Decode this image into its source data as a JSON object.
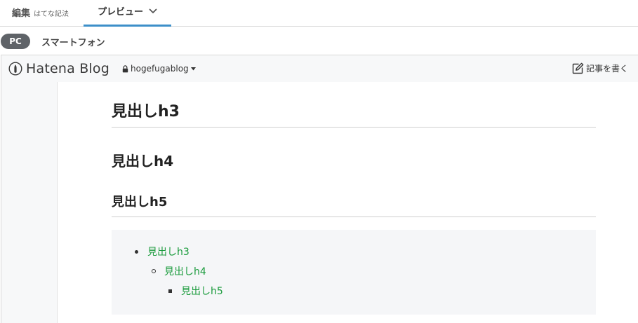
{
  "editor_tabs": {
    "edit_label": "編集",
    "edit_sub": "はてな記法",
    "preview_label": "プレビュー"
  },
  "device": {
    "pc": "PC",
    "smartphone": "スマートフォン"
  },
  "blog_bar": {
    "logo_text": "Hatena Blog",
    "blog_name": "hogefugablog",
    "write_label": "記事を書く"
  },
  "article": {
    "h3": "見出しh3",
    "h4": "見出しh4",
    "h5": "見出しh5",
    "toc": [
      "見出しh3",
      "見出しh4",
      "見出しh5"
    ]
  },
  "colors": {
    "accent": "#3d8fc9",
    "link": "#1a9b3c",
    "pc_badge": "#5f6368"
  }
}
